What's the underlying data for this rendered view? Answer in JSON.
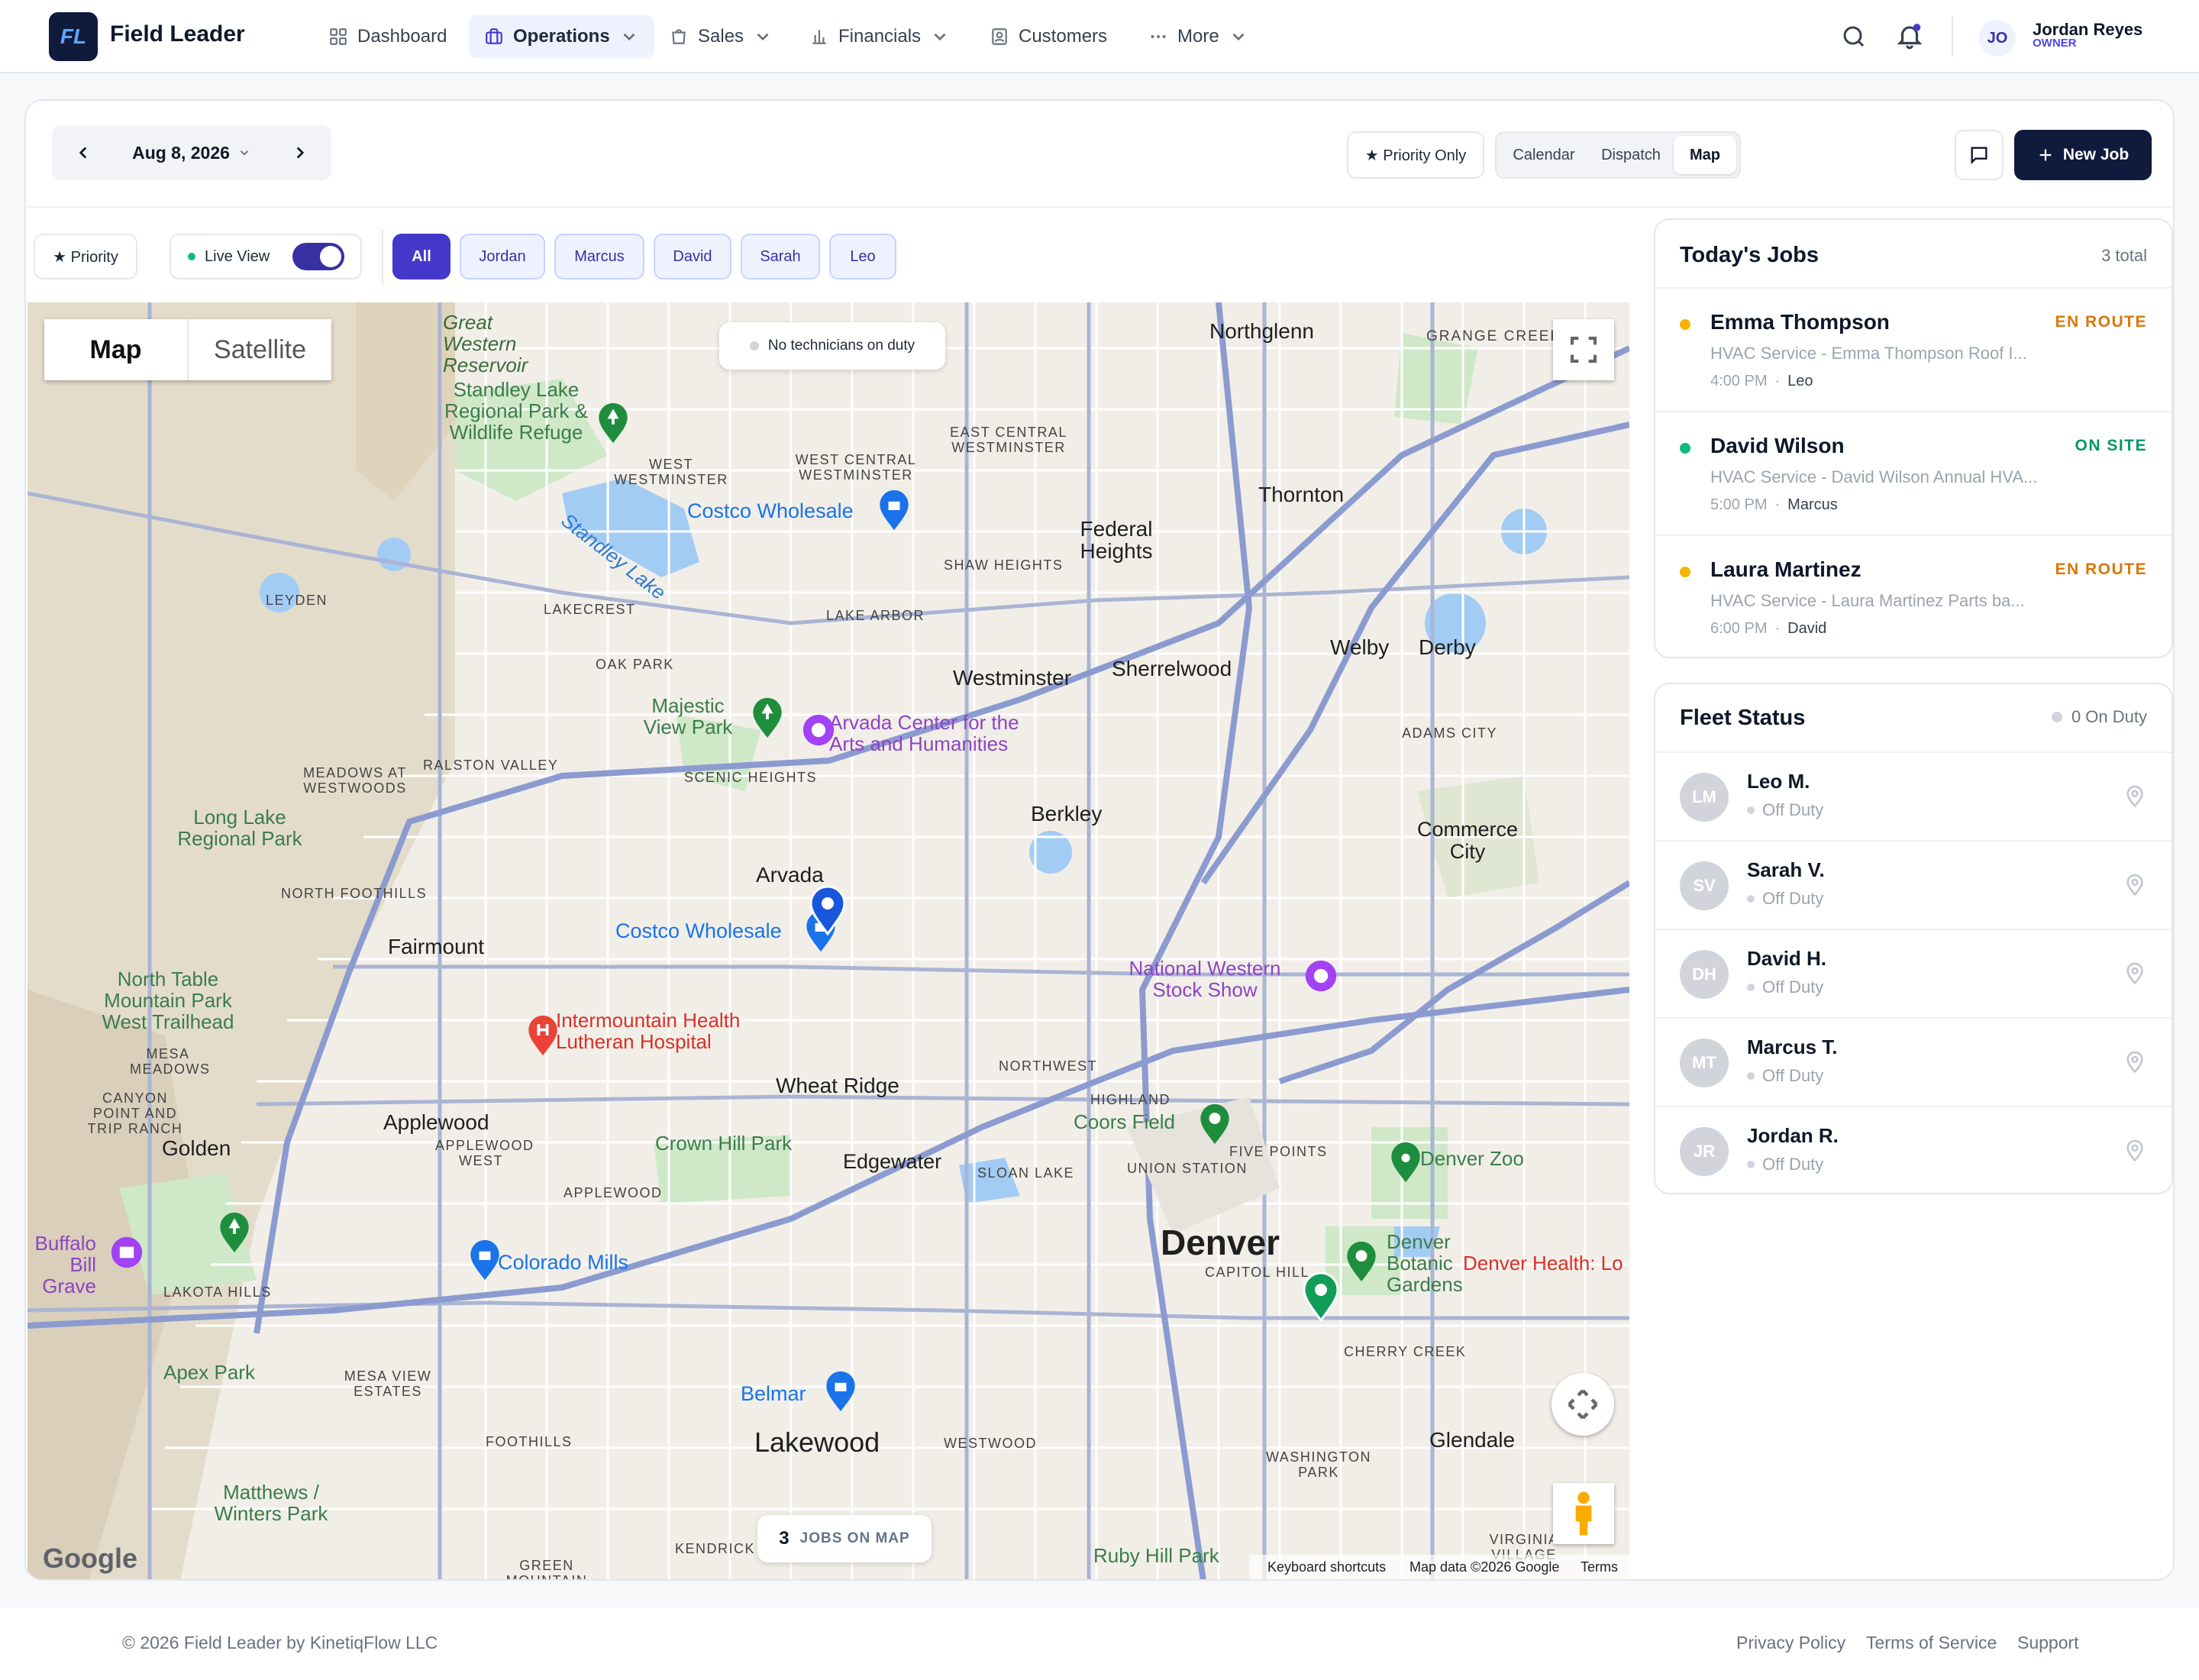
{
  "brand": {
    "logo_text": "FL",
    "name": "Field Leader"
  },
  "nav": {
    "items": [
      {
        "label": "Dashboard"
      },
      {
        "label": "Operations"
      },
      {
        "label": "Sales"
      },
      {
        "label": "Financials"
      },
      {
        "label": "Customers"
      },
      {
        "label": "More"
      }
    ]
  },
  "user": {
    "initials": "JO",
    "name": "Jordan Reyes",
    "role": "OWNER"
  },
  "toolbar": {
    "date": "Aug 8, 2026",
    "priority_only": "★ Priority Only",
    "views": [
      "Calendar",
      "Dispatch",
      "Map"
    ],
    "active_view": "Map",
    "new_job": "New Job"
  },
  "filters": {
    "priority": "★ Priority",
    "live_view": "Live View",
    "technicians": [
      "All",
      "Jordan",
      "Marcus",
      "David",
      "Sarah",
      "Leo"
    ]
  },
  "map": {
    "type_map": "Map",
    "type_satellite": "Satellite",
    "no_tech": "No technicians on duty",
    "jobs_count": "3",
    "jobs_label": "JOBS ON MAP",
    "google": "Google",
    "keyboard": "Keyboard shortcuts",
    "data": "Map data ©2026 Google",
    "terms": "Terms",
    "labels": {
      "great_western": "Great Western Reservoir",
      "standley_refuge": "Standley Lake Regional Park & Wildlife Refuge",
      "standley_lake": "Standley Lake",
      "costco1": "Costco Wholesale",
      "costco2": "Costco Wholesale",
      "northglenn": "Northglenn",
      "grange_creek": "GRANGE CREEK",
      "west_westminster": "WEST WESTMINSTER",
      "west_central": "WEST CENTRAL WESTMINSTER",
      "east_central": "EAST CENTRAL WESTMINSTER",
      "thornton": "Thornton",
      "federal_heights": "Federal Heights",
      "shaw_heights": "SHAW HEIGHTS",
      "leyden": "LEYDEN",
      "lakecrest": "LAKECREST",
      "lake_arbor": "LAKE ARBOR",
      "oak_park": "OAK PARK",
      "westminster": "Westminster",
      "sherrelwood": "Sherrelwood",
      "welby": "Welby",
      "derby": "Derby",
      "majestic": "Majestic View Park",
      "arvada_center": "Arvada Center for the Arts and Humanities",
      "adams_city": "ADAMS CITY",
      "meadows": "MEADOWS AT WESTWOODS",
      "ralston": "RALSTON VALLEY",
      "scenic": "SCENIC HEIGHTS",
      "long_lake": "Long Lake Regional Park",
      "berkley": "Berkley",
      "commerce_city": "Commerce City",
      "north_foothills": "NORTH FOOTHILLS",
      "arvada": "Arvada",
      "fairmount": "Fairmount",
      "north_table": "North Table Mountain Park West Trailhead",
      "national_western": "National Western Stock Show",
      "intermountain": "Intermountain Health Lutheran Hospital",
      "mesa_meadows": "MESA MEADOWS",
      "northwest": "NORTHWEST",
      "canyon_point": "CANYON POINT AND TRIP RANCH",
      "wheat_ridge": "Wheat Ridge",
      "highland": "HIGHLAND",
      "coors_field": "Coors Field",
      "applewood": "Applewood",
      "applewood_west": "APPLEWOOD WEST",
      "golden": "Golden",
      "crown_hill": "Crown Hill Park",
      "edgewater": "Edgewater",
      "sloan_lake": "SLOAN LAKE",
      "union_station": "UNION STATION",
      "five_points": "FIVE POINTS",
      "denver_zoo": "Denver Zoo",
      "applewood2": "APPLEWOOD",
      "buffalo_bill": "Buffalo Bill Grave",
      "denver": "Denver",
      "capitol_hill": "CAPITOL HILL",
      "botanic": "Denver Botanic Gardens",
      "denver_health": "Denver Health: Lo Family Health Cen",
      "colorado_mills": "Colorado Mills",
      "lakota_hills": "LAKOTA HILLS",
      "apex_park": "Apex Park",
      "mesa_view": "MESA VIEW ESTATES",
      "cherry_creek": "CHERRY CREEK",
      "belmar": "Belmar",
      "lakewood": "Lakewood",
      "westwood": "WESTWOOD",
      "foothills": "FOOTHILLS",
      "glendale": "Glendale",
      "washington_park": "WASHINGTON PARK",
      "matthews": "Matthews / Winters Park",
      "kendrick": "KENDRICK",
      "green_mountain": "GREEN MOUNTAIN",
      "ruby_hill": "Ruby Hill Park",
      "virginia_village": "VIRGINIA VILLAGE"
    }
  },
  "todays_jobs": {
    "title": "Today's Jobs",
    "total": "3 total",
    "jobs": [
      {
        "name": "Emma Thompson",
        "status": "EN ROUTE",
        "status_color": "#d97706",
        "dot": "#f5b400",
        "desc": "HVAC Service - Emma Thompson Roof I...",
        "time": "4:00 PM",
        "tech": "Leo"
      },
      {
        "name": "David Wilson",
        "status": "ON SITE",
        "status_color": "#059669",
        "dot": "#10b981",
        "desc": "HVAC Service - David Wilson Annual HVA...",
        "time": "5:00 PM",
        "tech": "Marcus"
      },
      {
        "name": "Laura Martinez",
        "status": "EN ROUTE",
        "status_color": "#d97706",
        "dot": "#f5b400",
        "desc": "HVAC Service - Laura Martinez Parts ba...",
        "time": "6:00 PM",
        "tech": "David"
      }
    ]
  },
  "fleet": {
    "title": "Fleet Status",
    "on_duty": "0 On Duty",
    "techs": [
      {
        "initials": "LM",
        "name": "Leo M.",
        "status": "Off Duty"
      },
      {
        "initials": "SV",
        "name": "Sarah V.",
        "status": "Off Duty"
      },
      {
        "initials": "DH",
        "name": "David H.",
        "status": "Off Duty"
      },
      {
        "initials": "MT",
        "name": "Marcus T.",
        "status": "Off Duty"
      },
      {
        "initials": "JR",
        "name": "Jordan R.",
        "status": "Off Duty"
      }
    ]
  },
  "footer": {
    "copyright": "© 2026 Field Leader by KinetiqFlow LLC",
    "links": [
      "Privacy Policy",
      "Terms of Service",
      "Support"
    ]
  },
  "colors": {
    "brand_navy": "#0f1a3d",
    "accent": "#4338ca",
    "en_route": "#d97706",
    "on_site": "#059669"
  }
}
